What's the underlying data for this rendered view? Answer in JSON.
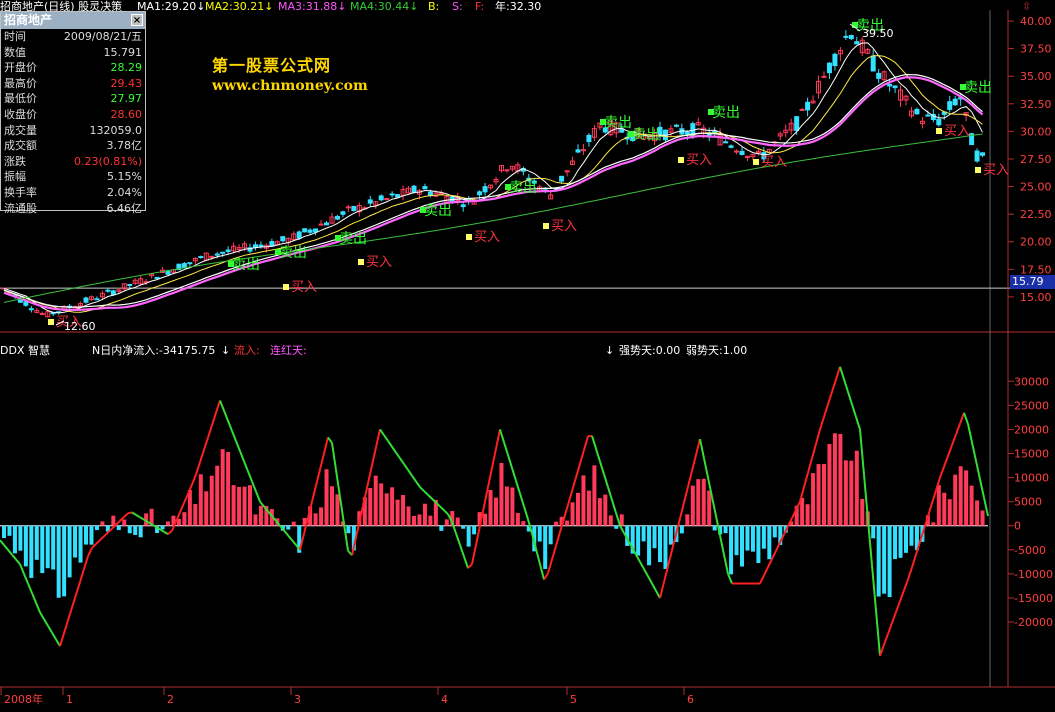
{
  "header": {
    "stock_title": "招商地产(日线) 股灵决策",
    "legend": [
      {
        "label": "MA1:29.20",
        "color": "#ffffff"
      },
      {
        "label": "MA2:30.21",
        "color": "#ffff00"
      },
      {
        "label": "MA3:31.88",
        "color": "#ff55ff"
      },
      {
        "label": "MA4:30.44",
        "color": "#33cc33"
      },
      {
        "label": "B:",
        "color": "#ffff00"
      },
      {
        "label": "S:",
        "color": "#ff55ff"
      },
      {
        "label": "F:",
        "color": "#ff3333"
      },
      {
        "label": "年:32.30",
        "color": "#ffffff"
      }
    ],
    "arrow": "↓",
    "corner_mark": "⇳"
  },
  "info_box": {
    "title": "招商地产",
    "close": "×",
    "rows": [
      {
        "label": "时间",
        "value": "2009/08/21/五",
        "color": "#dddddd"
      },
      {
        "label": "数值",
        "value": "15.791",
        "color": "#dddddd"
      },
      {
        "label": "开盘价",
        "value": "28.29",
        "color": "#33ff33"
      },
      {
        "label": "最高价",
        "value": "29.43",
        "color": "#ff3333"
      },
      {
        "label": "最低价",
        "value": "27.97",
        "color": "#33ff33"
      },
      {
        "label": "收盘价",
        "value": "28.60",
        "color": "#ff3333"
      },
      {
        "label": "成交量",
        "value": "132059.0",
        "color": "#dddddd"
      },
      {
        "label": "成交额",
        "value": "3.78亿",
        "color": "#dddddd"
      },
      {
        "label": "涨跌",
        "value": "0.23(0.81%)",
        "color": "#ff3333"
      },
      {
        "label": "振幅",
        "value": "5.15%",
        "color": "#dddddd"
      },
      {
        "label": "换手率",
        "value": "2.04%",
        "color": "#dddddd"
      },
      {
        "label": "流通股",
        "value": "6.46亿",
        "color": "#dddddd"
      }
    ]
  },
  "watermark": {
    "line1": "第一股票公式网",
    "line2": "www.chnmoney.com"
  },
  "signals": {
    "sell": "卖出",
    "buy": "买入"
  },
  "chart_data": [
    {
      "type": "candlestick",
      "title": "招商地产(日线) 股灵决策",
      "ylim": [
        12.0,
        41.0
      ],
      "y_ticks": [
        15.0,
        17.5,
        20.0,
        22.5,
        25.0,
        27.5,
        30.0,
        32.5,
        35.0,
        37.5,
        40.0
      ],
      "current_price_label": "15.79",
      "extreme_labels": [
        "39.50",
        "12.60"
      ],
      "series": [
        {
          "name": "MA1",
          "value": "29.20"
        },
        {
          "name": "MA2",
          "value": "30.21"
        },
        {
          "name": "MA3",
          "value": "31.88"
        },
        {
          "name": "MA4",
          "value": "30.44"
        },
        {
          "name": "B",
          "value": "-"
        },
        {
          "name": "S",
          "value": "-"
        },
        {
          "name": "F",
          "value": "-"
        },
        {
          "name": "年",
          "value": "32.30"
        }
      ]
    },
    {
      "type": "bar+line",
      "title": "DDX 智慧",
      "ylim": [
        -31000,
        34000
      ],
      "y_ticks": [
        30000,
        25000,
        20000,
        15000,
        10000,
        5000,
        0,
        -5000,
        -10000,
        -15000,
        -20000
      ],
      "series": [
        {
          "name": "N日内净流入",
          "value": "-34175.75"
        },
        {
          "name": "流入",
          "value": "-"
        },
        {
          "name": "连红天",
          "value": "-"
        },
        {
          "name": "强势天",
          "value": "0.00"
        },
        {
          "name": "弱势天",
          "value": "1.00"
        }
      ]
    }
  ],
  "lower_header": {
    "title": "DDX 智慧",
    "net_flow": "N日内净流入:-34175.75",
    "flow_in": "流入:",
    "red_days": "连红天:",
    "strong_days": "强势天:0.00",
    "weak_days": "弱势天:1.00",
    "arrow": "↓"
  },
  "x_axis": {
    "labels": [
      "2008年",
      "1",
      "2",
      "3",
      "4",
      "5",
      "6"
    ]
  },
  "colors": {
    "up": "#ff3a5a",
    "down": "#33e0ff",
    "ma_white": "#ffffff",
    "ma_yellow": "#ffe84a",
    "ma_pink": "#ff66ff",
    "ma_green": "#3bbf3b",
    "axis": "#b03030",
    "tick_text": "#ff4040",
    "ddx_up_line": "#ff2020",
    "ddx_down_line": "#33dd33",
    "sell_label": "#33ff33",
    "buy_label": "#ff3344"
  }
}
